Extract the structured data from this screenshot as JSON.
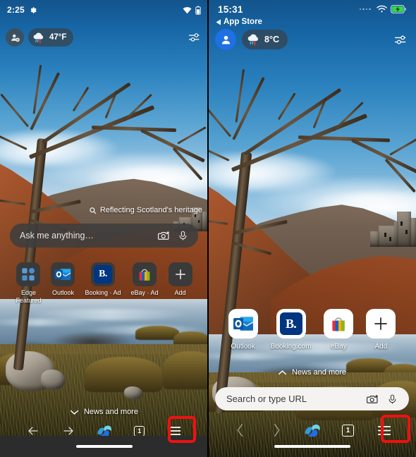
{
  "meta": {
    "description": "Side-by-side comparison of Microsoft Edge browser new-tab home screen on Android (left) and iOS (right), both showing the Scottish loch wallpaper; the bottom-right hamburger menu button is highlighted with a red box in each."
  },
  "accent": {
    "highlight_red": "#ee1111",
    "edge_blue": "#1f6fe5",
    "outlook_blue": "#0F6CBD",
    "booking_blue": "#003580",
    "ebay_red": "#E53238",
    "ebay_blue": "#0064D2",
    "ebay_yellow": "#F5AF02",
    "ebay_green": "#86B817",
    "battery_green": "#32d74b"
  },
  "left_phone": {
    "platform_label": "android",
    "statusbar": {
      "time": "2:25",
      "gear_icon": "gear-icon",
      "wifi_icon": "wifi-icon",
      "battery_icon": "battery-icon"
    },
    "toprow": {
      "avatar_icon": "account-add-icon",
      "weather_icon": "rain-cloud-icon",
      "weather_value": "47°F",
      "tuner_icon": "tuner-settings-icon"
    },
    "suggestion": {
      "search_icon": "search-icon",
      "text": "Reflecting Scotland's heritage"
    },
    "searchbox": {
      "placeholder": "Ask me anything…",
      "camera_icon": "camera-lens-icon",
      "mic_icon": "microphone-icon"
    },
    "tiles": [
      {
        "name": "Edge Featured",
        "label": "Edge\nFeatured",
        "icon": "edge-featured-grid-icon"
      },
      {
        "name": "Outlook",
        "label": "Outlook",
        "icon": "outlook-icon"
      },
      {
        "name": "Booking Ad",
        "label": "Booking · Ad",
        "icon": "booking-icon"
      },
      {
        "name": "eBay Ad",
        "label": "eBay · Ad",
        "icon": "ebay-icon"
      },
      {
        "name": "Add",
        "label": "Add",
        "icon": "plus-icon"
      }
    ],
    "news_more": {
      "chevron": "chevron-down-icon",
      "label": "News and more"
    },
    "bottomnav": {
      "back_icon": "arrow-back-icon",
      "forward_icon": "arrow-forward-icon",
      "copilot_icon": "copilot-icon",
      "tab_count": "1",
      "menu_icon": "hamburger-menu-icon",
      "menu_highlighted": "true"
    }
  },
  "right_phone": {
    "platform_label": "ios",
    "statusbar": {
      "time": "15:31",
      "signal_icon": "signal-dots-icon",
      "wifi_icon": "wifi-icon",
      "battery_icon": "battery-charging-icon"
    },
    "back_link": {
      "arrow_icon": "back-triangle-icon",
      "label": "App Store"
    },
    "toprow": {
      "avatar_icon": "account-icon",
      "weather_icon": "rain-cloud-icon",
      "weather_value": "8°C",
      "tuner_icon": "tuner-settings-icon"
    },
    "tiles": [
      {
        "name": "Outlook",
        "label": "Outlook",
        "icon": "outlook-icon"
      },
      {
        "name": "Booking.com",
        "label": "Booking.com",
        "icon": "booking-icon"
      },
      {
        "name": "eBay",
        "label": "eBay",
        "icon": "ebay-icon"
      },
      {
        "name": "Add",
        "label": "Add",
        "icon": "plus-icon"
      }
    ],
    "news_more": {
      "chevron": "chevron-up-icon",
      "label": "News and more"
    },
    "searchbox": {
      "placeholder": "Search or type URL",
      "camera_icon": "camera-lens-icon",
      "mic_icon": "microphone-icon"
    },
    "bottomnav": {
      "back_icon": "chevron-back-icon",
      "forward_icon": "chevron-forward-icon",
      "copilot_icon": "copilot-icon",
      "tab_count": "1",
      "menu_icon": "hamburger-menu-icon",
      "menu_highlighted": "true"
    }
  }
}
